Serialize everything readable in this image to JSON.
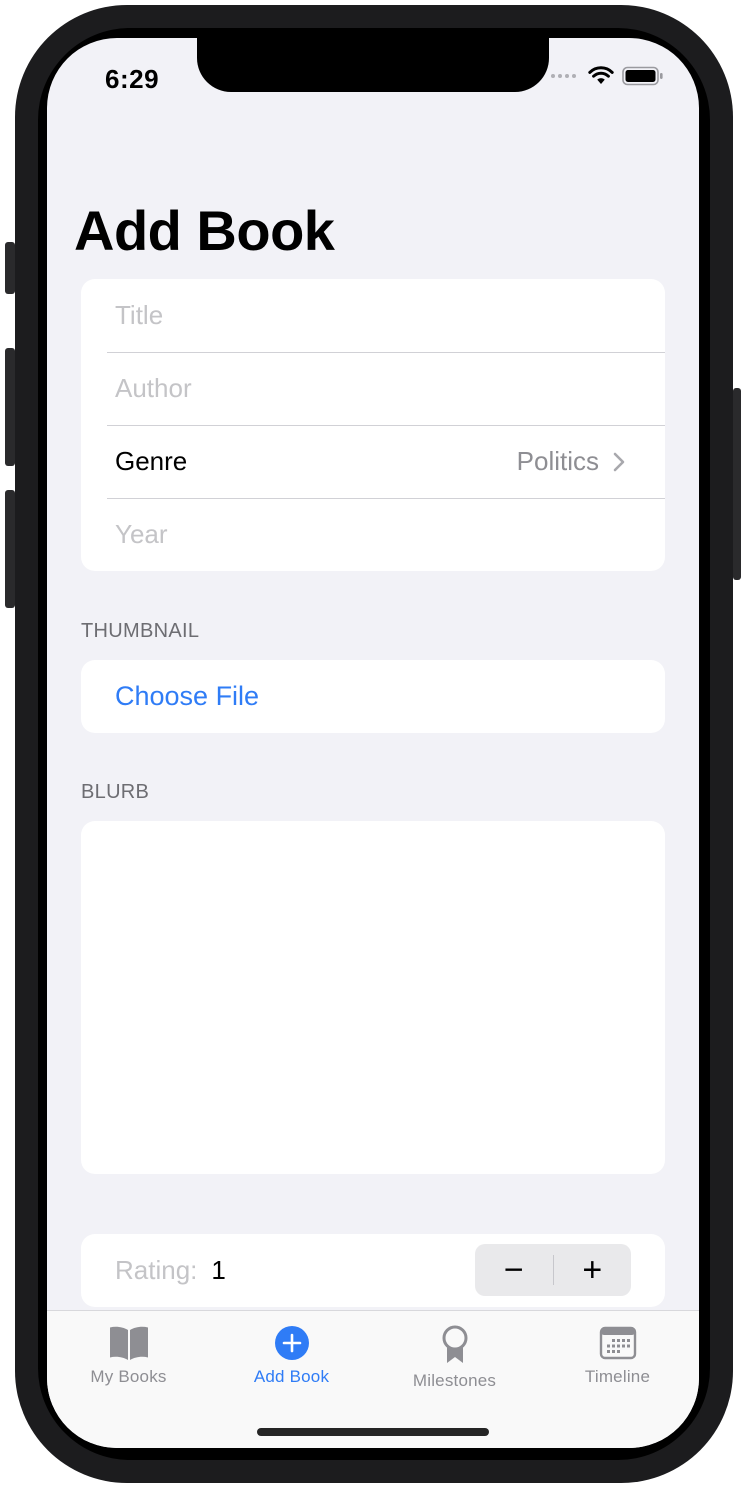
{
  "status_bar": {
    "time": "6:29"
  },
  "page_title": "Add Book",
  "form": {
    "title_placeholder": "Title",
    "author_placeholder": "Author",
    "genre_label": "Genre",
    "genre_value": "Politics",
    "year_placeholder": "Year"
  },
  "thumbnail": {
    "header": "THUMBNAIL",
    "choose_file": "Choose File"
  },
  "blurb": {
    "header": "BLURB",
    "value": ""
  },
  "rating": {
    "label": "Rating:",
    "value": "1",
    "decrement": "−",
    "increment": "+"
  },
  "tab_bar": {
    "items": [
      {
        "label": "My Books",
        "icon": "book-icon",
        "active": false
      },
      {
        "label": "Add Book",
        "icon": "plus-circle-icon",
        "active": true
      },
      {
        "label": "Milestones",
        "icon": "rosette-icon",
        "active": false
      },
      {
        "label": "Timeline",
        "icon": "calendar-icon",
        "active": false
      }
    ]
  },
  "colors": {
    "accent": "#2f7cf6",
    "background": "#f2f2f7",
    "placeholder": "#c4c4c7"
  }
}
